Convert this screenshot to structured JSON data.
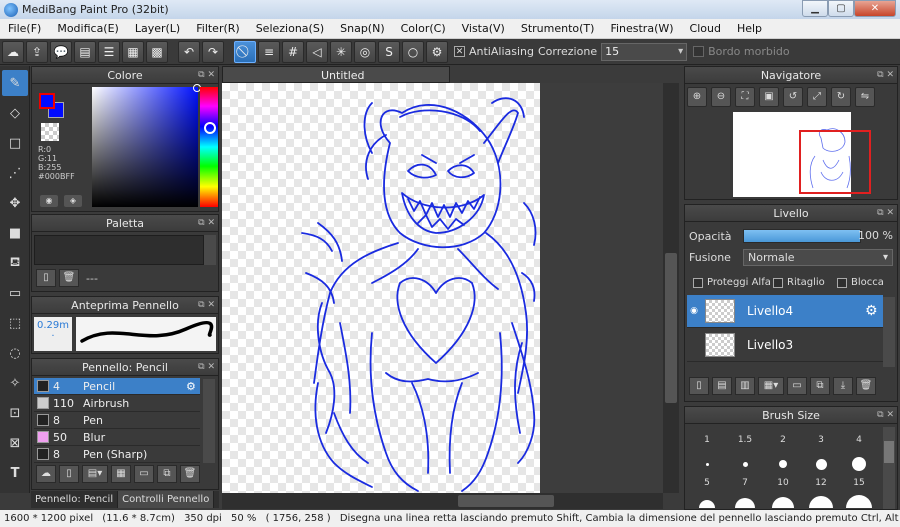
{
  "window": {
    "title": "MediBang Paint Pro (32bit)"
  },
  "menu": [
    "File(F)",
    "Modifica(E)",
    "Layer(L)",
    "Filter(R)",
    "Seleziona(S)",
    "Snap(N)",
    "Color(C)",
    "Vista(V)",
    "Strumento(T)",
    "Finestra(W)",
    "Cloud",
    "Help"
  ],
  "toolbar": {
    "antialiasing_label": "AntiAliasing",
    "correzione_label": "Correzione",
    "correzione_value": "15",
    "bordo_label": "Bordo morbido"
  },
  "color_panel": {
    "title": "Colore",
    "r": "R:0",
    "g": "G:11",
    "b": "B:255",
    "hex": "#000BFF",
    "fg_color": "#000bff"
  },
  "palette_panel": {
    "title": "Paletta",
    "dash": "---"
  },
  "brush_preview": {
    "title": "Anteprima Pennello",
    "size": "0.29m"
  },
  "brush_panel": {
    "title": "Pennello: Pencil",
    "items": [
      {
        "size": "4",
        "name": "Pencil",
        "color": "#222222",
        "active": true
      },
      {
        "size": "110",
        "name": "Airbrush",
        "color": "#cccccc",
        "active": false
      },
      {
        "size": "8",
        "name": "Pen",
        "color": "#222222",
        "active": false
      },
      {
        "size": "50",
        "name": "Blur",
        "color": "#f0a0f0",
        "active": false
      },
      {
        "size": "8",
        "name": "Pen (Sharp)",
        "color": "#222222",
        "active": false
      }
    ]
  },
  "left_tabs": [
    "Pennello: Pencil",
    "Controlli Pennello"
  ],
  "canvas": {
    "tab_title": "Untitled"
  },
  "navigator": {
    "title": "Navigatore"
  },
  "layer_panel": {
    "title": "Livello",
    "opacity_label": "Opacità",
    "opacity_value": "100 %",
    "opacity": 1.0,
    "fusion_label": "Fusione",
    "fusion_value": "Normale",
    "checks": [
      "Proteggi Alfa",
      "Ritaglio",
      "Blocca"
    ],
    "layers": [
      {
        "name": "Livello4",
        "active": true
      },
      {
        "name": "Livello3",
        "active": false
      }
    ]
  },
  "brush_size_panel": {
    "title": "Brush Size",
    "sizes": [
      "1",
      "1.5",
      "2",
      "3",
      "4",
      "5",
      "7",
      "10",
      "12",
      "15"
    ]
  },
  "status": {
    "dimensions": "1600 * 1200 pixel",
    "cm": "(11.6 * 8.7cm)",
    "dpi": "350 dpi",
    "zoom": "50 %",
    "coords": "( 1756, 258 )",
    "hint": "Disegna una linea retta lasciando premuto Shift, Cambia la dimensione del pennello lasciando premuto Ctrl, Alt e trascina"
  }
}
